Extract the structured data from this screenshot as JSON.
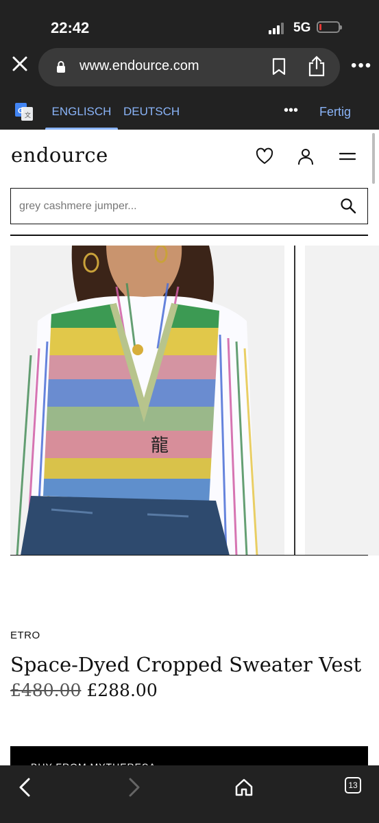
{
  "status": {
    "time": "22:42",
    "network": "5G"
  },
  "browser": {
    "url": "www.endource.com",
    "icons": [
      "close-icon",
      "lock-icon",
      "bookmark-icon",
      "share-icon",
      "more-icon"
    ]
  },
  "translate_bar": {
    "lang_source": "ENGLISCH",
    "lang_target": "DEUTSCH",
    "more": "•••",
    "done": "Fertig"
  },
  "header": {
    "brand": "endource",
    "icons": [
      "heart-icon",
      "account-icon",
      "menu-icon"
    ]
  },
  "search": {
    "placeholder": "grey cashmere jumper..."
  },
  "product": {
    "designer": "ETRO",
    "title": "Space-Dyed Cropped Sweater Vest",
    "price_original": "£480.00",
    "price_sale": "£288.00",
    "buy_label": "BUY FROM MYTHERESA"
  },
  "bottom_nav": {
    "tab_count": "13"
  },
  "colors": {
    "chrome": "#222222",
    "accent": "#8ab4f8",
    "text": "#111111"
  }
}
